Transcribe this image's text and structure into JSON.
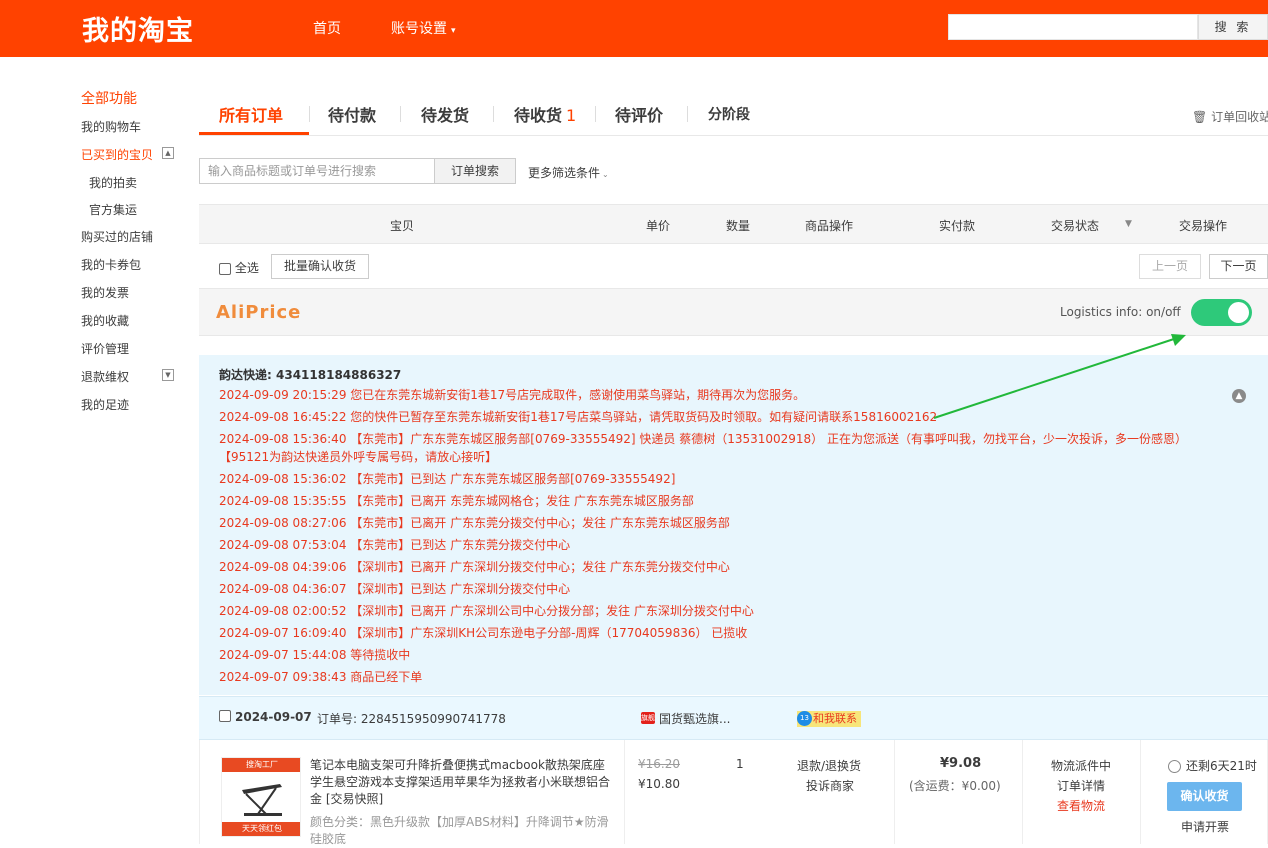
{
  "header": {
    "logo": "我的淘宝",
    "nav": {
      "home": "首页",
      "account": "账号设置"
    },
    "search": {
      "button": "搜 索",
      "placeholder": ""
    }
  },
  "sidebar": {
    "title": "全部功能",
    "items": [
      {
        "label": "我的购物车"
      },
      {
        "label": "已买到的宝贝"
      },
      {
        "label": "我的拍卖"
      },
      {
        "label": "官方集运"
      },
      {
        "label": "购买过的店铺"
      },
      {
        "label": "我的卡券包"
      },
      {
        "label": "我的发票"
      },
      {
        "label": "我的收藏"
      },
      {
        "label": "评价管理"
      },
      {
        "label": "退款维权"
      },
      {
        "label": "我的足迹"
      }
    ]
  },
  "tabs": {
    "all": "所有订单",
    "to_pay": "待付款",
    "to_ship": "待发货",
    "to_receive": "待收货",
    "to_receive_count": "1",
    "to_review": "待评价",
    "installment": "分阶段",
    "recycle": "订单回收站"
  },
  "filter": {
    "search_placeholder": "输入商品标题或订单号进行搜索",
    "search_button": "订单搜索",
    "more": "更多筛选条件"
  },
  "table_header": {
    "item": "宝贝",
    "unit_price": "单价",
    "qty": "数量",
    "item_ops": "商品操作",
    "paid": "实付款",
    "status": "交易状态",
    "trade_ops": "交易操作"
  },
  "toolbar": {
    "select_all": "全选",
    "batch_confirm": "批量确认收货",
    "prev": "上一页",
    "next": "下一页"
  },
  "aliprice": {
    "logo": "AliPrice",
    "logistics_label": "Logistics info: on/off",
    "toggle_on": true
  },
  "logistics": {
    "courier_label": "韵达快递:",
    "tracking_no": "434118184886327",
    "lines": [
      "2024-09-09 20:15:29 您已在东莞东城新安街1巷17号店完成取件，感谢使用菜鸟驿站，期待再次为您服务。",
      "2024-09-08 16:45:22 您的快件已暂存至东莞东城新安街1巷17号店菜鸟驿站，请凭取货码及时领取。如有疑问请联系15816002162",
      "2024-09-08 15:36:40 【东莞市】广东东莞东城区服务部[0769-33555492] 快递员 蔡德树（13531002918） 正在为您派送（有事呼叫我，勿找平台，少一次投诉，多一份感恩）【95121为韵达快递员外呼专属号码，请放心接听】",
      "2024-09-08 15:36:02 【东莞市】已到达 广东东莞东城区服务部[0769-33555492]",
      "2024-09-08 15:35:55 【东莞市】已离开 东莞东城网格仓；发往 广东东莞东城区服务部",
      "2024-09-08 08:27:06 【东莞市】已离开 广东东莞分拨交付中心；发往 广东东莞东城区服务部",
      "2024-09-08 07:53:04 【东莞市】已到达 广东东莞分拨交付中心",
      "2024-09-08 04:39:06 【深圳市】已离开 广东深圳分拨交付中心；发往 广东东莞分拨交付中心",
      "2024-09-08 04:36:07 【深圳市】已到达 广东深圳分拨交付中心",
      "2024-09-08 02:00:52 【深圳市】已离开 广东深圳公司中心分拨分部；发往 广东深圳分拨交付中心",
      "2024-09-07 16:09:40 【深圳市】广东深圳KH公司东逊电子分部-周辉（17704059836） 已揽收",
      "2024-09-07 15:44:08 等待揽收中",
      "2024-09-07 09:38:43 商品已经下单"
    ]
  },
  "order": {
    "date": "2024-09-07",
    "order_no_label": "订单号:",
    "order_no": "2284515950990741778",
    "shop_badge": "旗舰",
    "shop": "国货甄选旗...",
    "contact_badge": "13",
    "contact": "和我联系",
    "product_img_top": "搜淘工厂",
    "product_img_bottom": "天天领红包",
    "title": "笔记本电脑支架可升降折叠便携式macbook散热架底座学生悬空游戏本支撑架适用苹果华为拯救者小米联想铝合金 [交易快照]",
    "spec": "颜色分类：黑色升级款【加厚ABS材料】升降调节★防滑硅胶底",
    "orig_price": "¥16.20",
    "price": "¥10.80",
    "qty": "1",
    "refund": "退款/退换货",
    "complain": "投诉商家",
    "paid": "¥9.08",
    "shipping": "(含运费：¥0.00)",
    "status": "物流派件中",
    "detail": "订单详情",
    "view_logistics": "查看物流",
    "remaining": "还剩6天21时",
    "confirm": "确认收货",
    "invoice": "申请开票"
  },
  "colors": {
    "brand": "#ff4200",
    "toggle_on": "#2ec97a",
    "logistics_text": "#e8391f",
    "confirm_btn": "#6cb6ee",
    "annotation_arrow": "#22b83a"
  }
}
